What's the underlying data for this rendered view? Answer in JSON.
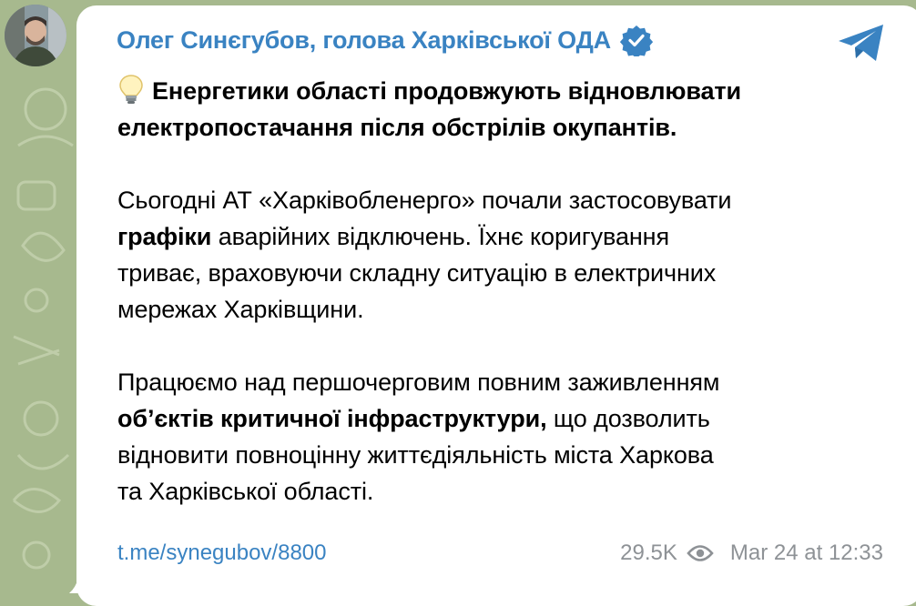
{
  "post": {
    "sender_name": "Олег Синєгубов, голова Харківської ОДА",
    "verified": true,
    "message": {
      "headline_line1": "Енергетики області продовжують відновлювати",
      "headline_line2": "електропостачання після обстрілів окупантів.",
      "p2_line1": "Сьогодні АТ «Харківобленерго» почали застосовувати",
      "p2_bold": "графіки",
      "p2_line2_rest": " аварійних відключень. Їхнє коригування",
      "p2_line3": "триває, враховуючи складну ситуацію в електричних",
      "p2_line4": "мережах Харківщини.",
      "p3_line1": "Працюємо над першочерговим повним заживленням",
      "p3_bold": "об’єктів критичної інфраструктури,",
      "p3_line2_rest": " що дозволить",
      "p3_line3": "відновити повноцінну життєдіяльність міста Харкова",
      "p3_line4": "та Харківської області."
    },
    "link": "t.me/synegubov/8800",
    "views": "29.5K",
    "timestamp": "Mar 24 at 12:33"
  },
  "colors": {
    "accent": "#3a83c2",
    "background": "#a7b98e",
    "meta": "#8e9296"
  },
  "icons": {
    "bulb": "light-bulb-icon",
    "verified": "verified-badge-icon",
    "share": "telegram-share-icon",
    "views": "eye-icon"
  }
}
